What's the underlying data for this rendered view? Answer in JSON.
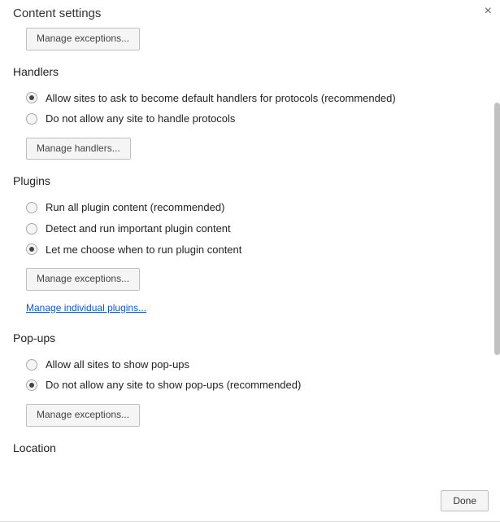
{
  "header": {
    "title": "Content settings"
  },
  "orphan": {
    "manage_exceptions": "Manage exceptions..."
  },
  "handlers": {
    "title": "Handlers",
    "selected": 0,
    "options": [
      "Allow sites to ask to become default handlers for protocols (recommended)",
      "Do not allow any site to handle protocols"
    ],
    "button": "Manage handlers..."
  },
  "plugins": {
    "title": "Plugins",
    "selected": 2,
    "options": [
      "Run all plugin content (recommended)",
      "Detect and run important plugin content",
      "Let me choose when to run plugin content"
    ],
    "button": "Manage exceptions...",
    "link": "Manage individual plugins..."
  },
  "popups": {
    "title": "Pop-ups",
    "selected": 1,
    "options": [
      "Allow all sites to show pop-ups",
      "Do not allow any site to show pop-ups (recommended)"
    ],
    "button": "Manage exceptions..."
  },
  "location": {
    "title": "Location"
  },
  "footer": {
    "done": "Done"
  }
}
